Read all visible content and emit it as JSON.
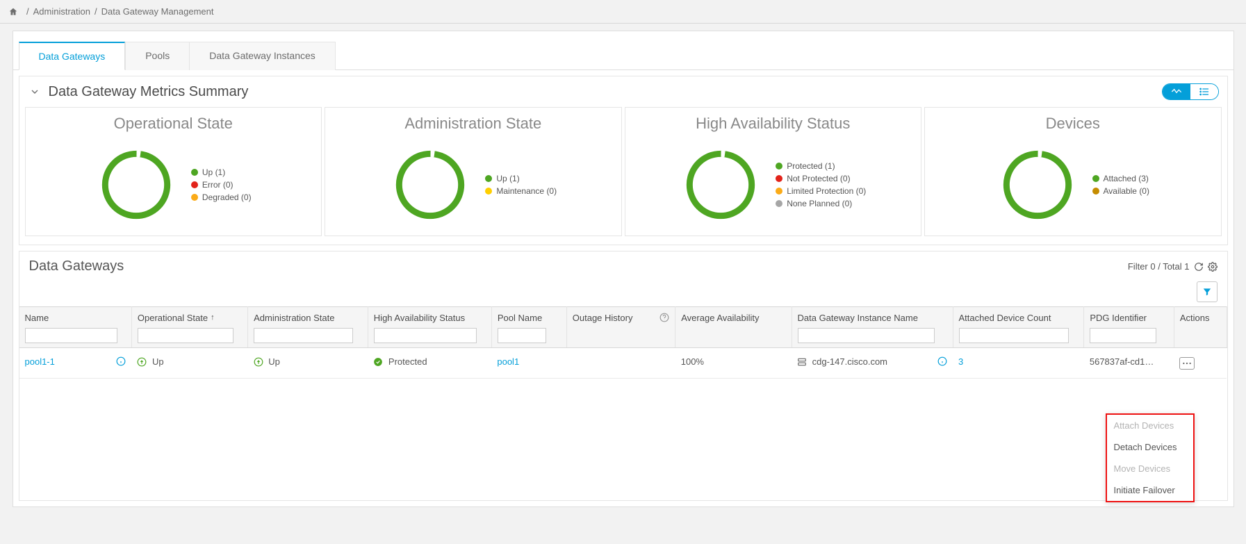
{
  "breadcrumb": {
    "level1": "Administration",
    "level2": "Data Gateway Management"
  },
  "tabs": {
    "t0": "Data Gateways",
    "t1": "Pools",
    "t2": "Data Gateway Instances"
  },
  "summary_title": "Data Gateway Metrics Summary",
  "colors": {
    "green": "#4ea622",
    "red": "#e2231a",
    "orange": "#fbab18",
    "yellow": "#ffcf00",
    "grey": "#a6a6a6",
    "brown": "#c58c00"
  },
  "cards": {
    "op": {
      "title": "Operational State",
      "legend": [
        {
          "label": "Up (1)",
          "color": "#4ea622"
        },
        {
          "label": "Error (0)",
          "color": "#e2231a"
        },
        {
          "label": "Degraded (0)",
          "color": "#fbab18"
        }
      ]
    },
    "admin": {
      "title": "Administration State",
      "legend": [
        {
          "label": "Up (1)",
          "color": "#4ea622"
        },
        {
          "label": "Maintenance (0)",
          "color": "#ffcf00"
        }
      ]
    },
    "ha": {
      "title": "High Availability Status",
      "legend": [
        {
          "label": "Protected (1)",
          "color": "#4ea622"
        },
        {
          "label": "Not Protected (0)",
          "color": "#e2231a"
        },
        {
          "label": "Limited Protection (0)",
          "color": "#fbab18"
        },
        {
          "label": "None Planned (0)",
          "color": "#a6a6a6"
        }
      ]
    },
    "dev": {
      "title": "Devices",
      "legend": [
        {
          "label": "Attached (3)",
          "color": "#4ea622"
        },
        {
          "label": "Available (0)",
          "color": "#c58c00"
        }
      ]
    }
  },
  "chart_data": [
    {
      "type": "pie",
      "title": "Operational State",
      "series": [
        {
          "name": "Up",
          "value": 1
        },
        {
          "name": "Error",
          "value": 0
        },
        {
          "name": "Degraded",
          "value": 0
        }
      ]
    },
    {
      "type": "pie",
      "title": "Administration State",
      "series": [
        {
          "name": "Up",
          "value": 1
        },
        {
          "name": "Maintenance",
          "value": 0
        }
      ]
    },
    {
      "type": "pie",
      "title": "High Availability Status",
      "series": [
        {
          "name": "Protected",
          "value": 1
        },
        {
          "name": "Not Protected",
          "value": 0
        },
        {
          "name": "Limited Protection",
          "value": 0
        },
        {
          "name": "None Planned",
          "value": 0
        }
      ]
    },
    {
      "type": "pie",
      "title": "Devices",
      "series": [
        {
          "name": "Attached",
          "value": 3
        },
        {
          "name": "Available",
          "value": 0
        }
      ]
    }
  ],
  "table": {
    "title": "Data Gateways",
    "filter_summary": "Filter 0 / Total 1",
    "headers": {
      "name": "Name",
      "op_state": "Operational State",
      "admin_state": "Administration State",
      "ha_status": "High Availability Status",
      "pool_name": "Pool Name",
      "outage": "Outage History",
      "avg_avail": "Average Availability",
      "dgi_name": "Data Gateway Instance Name",
      "dev_count": "Attached Device Count",
      "pdg_id": "PDG Identifier",
      "actions": "Actions"
    },
    "row": {
      "name": "pool1-1",
      "op_state": "Up",
      "admin_state": "Up",
      "ha_status": "Protected",
      "pool_name": "pool1",
      "outage": "",
      "avg_avail": "100%",
      "dgi_name": "cdg-147.cisco.com",
      "dev_count": "3",
      "pdg_id": "567837af-cd1…"
    }
  },
  "context_menu": {
    "attach": "Attach Devices",
    "detach": "Detach Devices",
    "move": "Move Devices",
    "failover": "Initiate Failover"
  }
}
